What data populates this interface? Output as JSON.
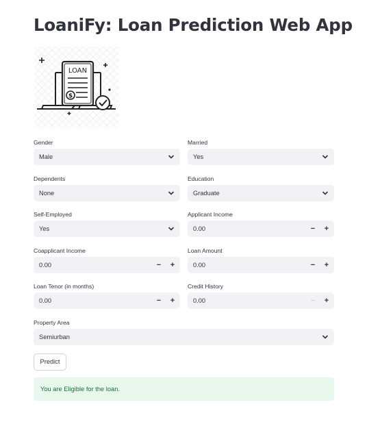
{
  "app": {
    "title": "LoaniFy: Loan Prediction Web App",
    "logo_text": "LOAN"
  },
  "form": {
    "gender": {
      "label": "Gender",
      "value": "Male"
    },
    "married": {
      "label": "Married",
      "value": "Yes"
    },
    "dependents": {
      "label": "Dependents",
      "value": "None"
    },
    "education": {
      "label": "Education",
      "value": "Graduate"
    },
    "self_employed": {
      "label": "Self-Employed",
      "value": "Yes"
    },
    "applicant_income": {
      "label": "Applicant Income",
      "value": "0.00"
    },
    "coapplicant_income": {
      "label": "Coapplicant Income",
      "value": "0.00"
    },
    "loan_amount": {
      "label": "Loan Amount",
      "value": "0.00"
    },
    "loan_tenor": {
      "label": "Loan Tenor (in months)",
      "value": "0.00"
    },
    "credit_history": {
      "label": "Credit History",
      "value": "0.00"
    },
    "property_area": {
      "label": "Property Area",
      "value": "Semiurban"
    },
    "stepper": {
      "minus": "−",
      "plus": "+"
    }
  },
  "predict_button": {
    "label": "Predict"
  },
  "result": {
    "message": "You are Eligible for the loan.",
    "status_color": "#e8f8ec"
  },
  "icons": {
    "select": "chevron-down-icon",
    "logo": "loan-document-icon"
  }
}
